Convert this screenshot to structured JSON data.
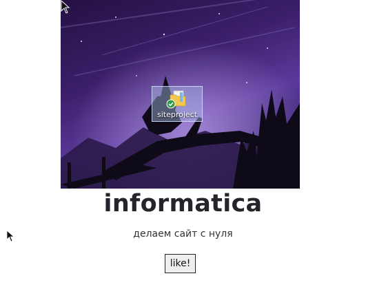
{
  "hero_image": {
    "desktop_icon": {
      "label": "siteproject",
      "icon": "folder-icon",
      "status_icon": "check-circle-icon"
    }
  },
  "title": "informatica",
  "subtitle": "делаем сайт с нуля",
  "like_button": {
    "label": "like!"
  },
  "colors": {
    "title": "#23252a",
    "sky_dark": "#241142",
    "sky_mid": "#5a3a9a",
    "silhouette": "#0e0a18"
  }
}
